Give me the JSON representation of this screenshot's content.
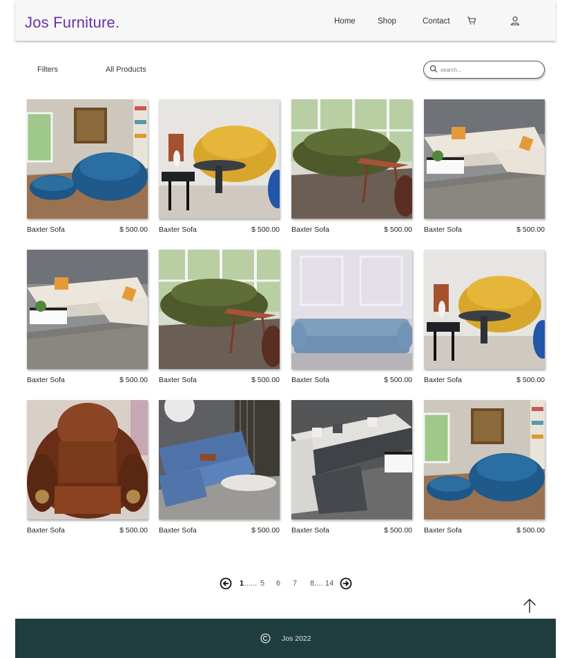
{
  "header": {
    "logo": "Jos Furniture.",
    "nav": {
      "home": "Home",
      "shop": "Shop",
      "contact": "Contact"
    },
    "icons": {
      "cart": "cart-icon",
      "user": "user-icon"
    }
  },
  "toolbar": {
    "filters_label": "Filters",
    "all_products_label": "All Products",
    "search_placeholder": "search..."
  },
  "products": [
    {
      "name": "Baxter Sofa",
      "price": "$ 500.00",
      "image": "blue-sofa-ottoman"
    },
    {
      "name": "Baxter Sofa",
      "price": "$ 500.00",
      "image": "yellow-sofa-table"
    },
    {
      "name": "Baxter Sofa",
      "price": "$ 500.00",
      "image": "green-sofa-window"
    },
    {
      "name": "Baxter Sofa",
      "price": "$ 500.00",
      "image": "white-sectional"
    },
    {
      "name": "Baxter Sofa",
      "price": "$ 500.00",
      "image": "white-sectional"
    },
    {
      "name": "Baxter Sofa",
      "price": "$ 500.00",
      "image": "green-sofa-window"
    },
    {
      "name": "Baxter Sofa",
      "price": "$ 500.00",
      "image": "light-blue-chesterfield"
    },
    {
      "name": "Baxter Sofa",
      "price": "$ 500.00",
      "image": "yellow-sofa-table"
    },
    {
      "name": "Baxter Sofa",
      "price": "$ 500.00",
      "image": "brown-leather-armchair"
    },
    {
      "name": "Baxter Sofa",
      "price": "$ 500.00",
      "image": "blue-recliner-sectional"
    },
    {
      "name": "Baxter Sofa",
      "price": "$ 500.00",
      "image": "grey-modern-sectional"
    },
    {
      "name": "Baxter Sofa",
      "price": "$ 500.00",
      "image": "blue-sofa-ottoman"
    }
  ],
  "pagination": {
    "current": "1",
    "dots1": "......",
    "p5": "5",
    "p6": "6",
    "p7": "7",
    "p8": "8....",
    "last": "14",
    "icons": {
      "prev": "arrow-left-circle-icon",
      "next": "arrow-right-circle-icon"
    }
  },
  "scroll_top_icon": "arrow-up-icon",
  "footer": {
    "copyright_icon": "copyright-icon",
    "text": "Jos 2022"
  },
  "colors": {
    "logo": "#6b2fa8",
    "footer_bg": "#1f3d3d",
    "header_bg": "#f7f7f7"
  }
}
